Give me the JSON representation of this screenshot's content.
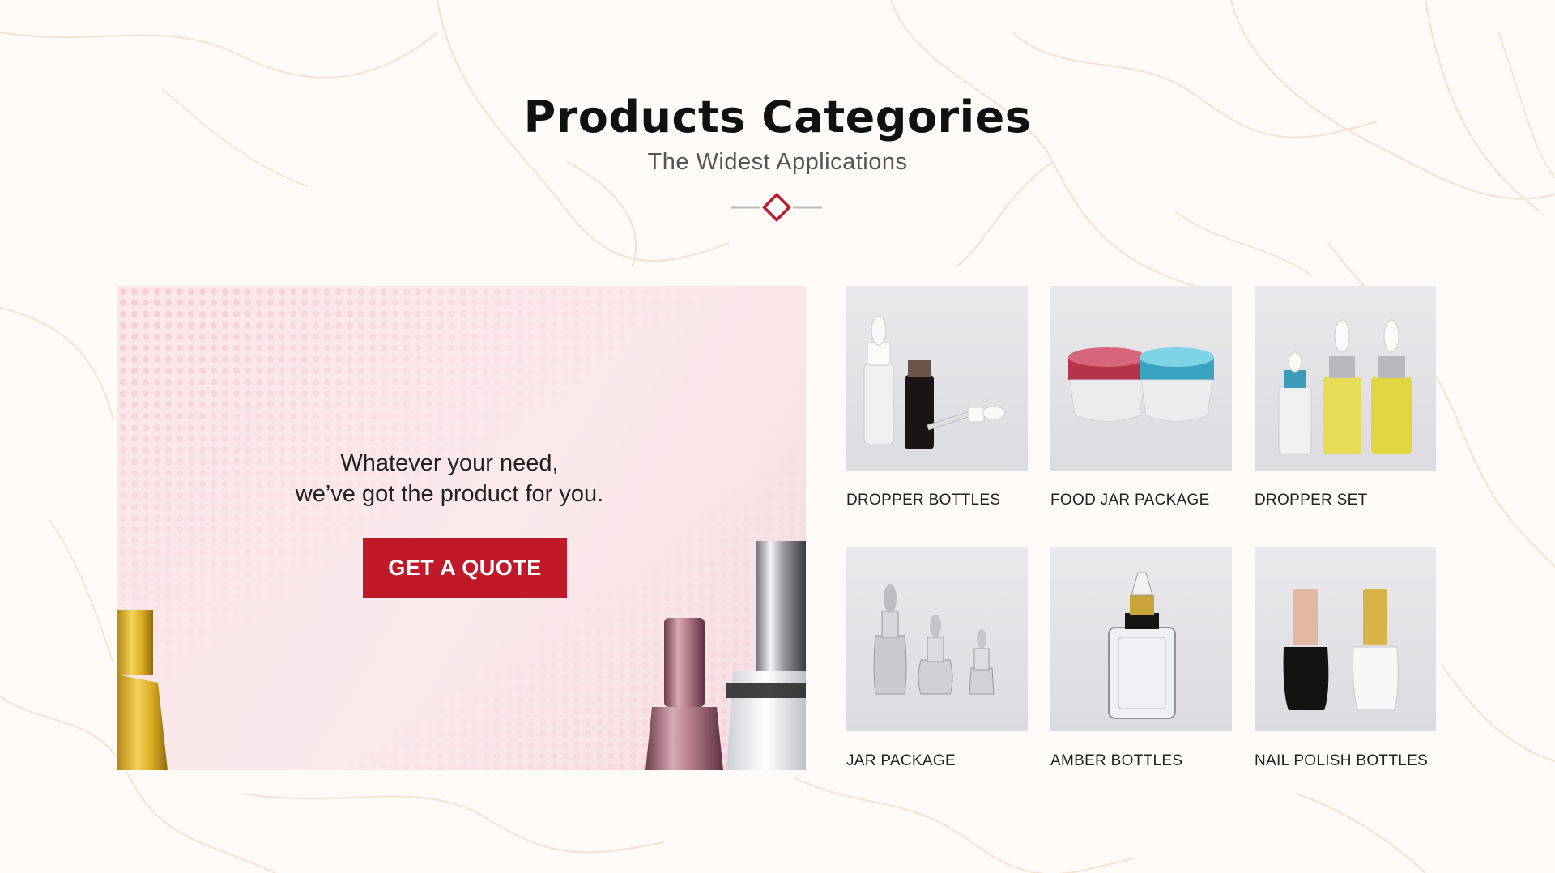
{
  "section": {
    "title": "Products Categories",
    "subtitle": "The Widest Applications"
  },
  "promo": {
    "line1": "Whatever your need,",
    "line2": "we’ve got the product for you.",
    "button_label": "GET A QUOTE"
  },
  "categories": [
    {
      "label": "DROPPER BOTTLES",
      "image": "dropper-bottles-image"
    },
    {
      "label": "FOOD JAR PACKAGE",
      "image": "food-jar-package-image"
    },
    {
      "label": "DROPPER SET",
      "image": "dropper-set-image"
    },
    {
      "label": "JAR PACKAGE",
      "image": "jar-package-image"
    },
    {
      "label": "AMBER BOTTLES",
      "image": "amber-bottles-image"
    },
    {
      "label": "NAIL POLISH BOTTLES",
      "image": "nail-polish-bottles-image"
    }
  ],
  "colors": {
    "accent": "#c01a2a",
    "title": "#111111",
    "subtitle": "#555555",
    "promo_bg": "#fbe6ea"
  }
}
